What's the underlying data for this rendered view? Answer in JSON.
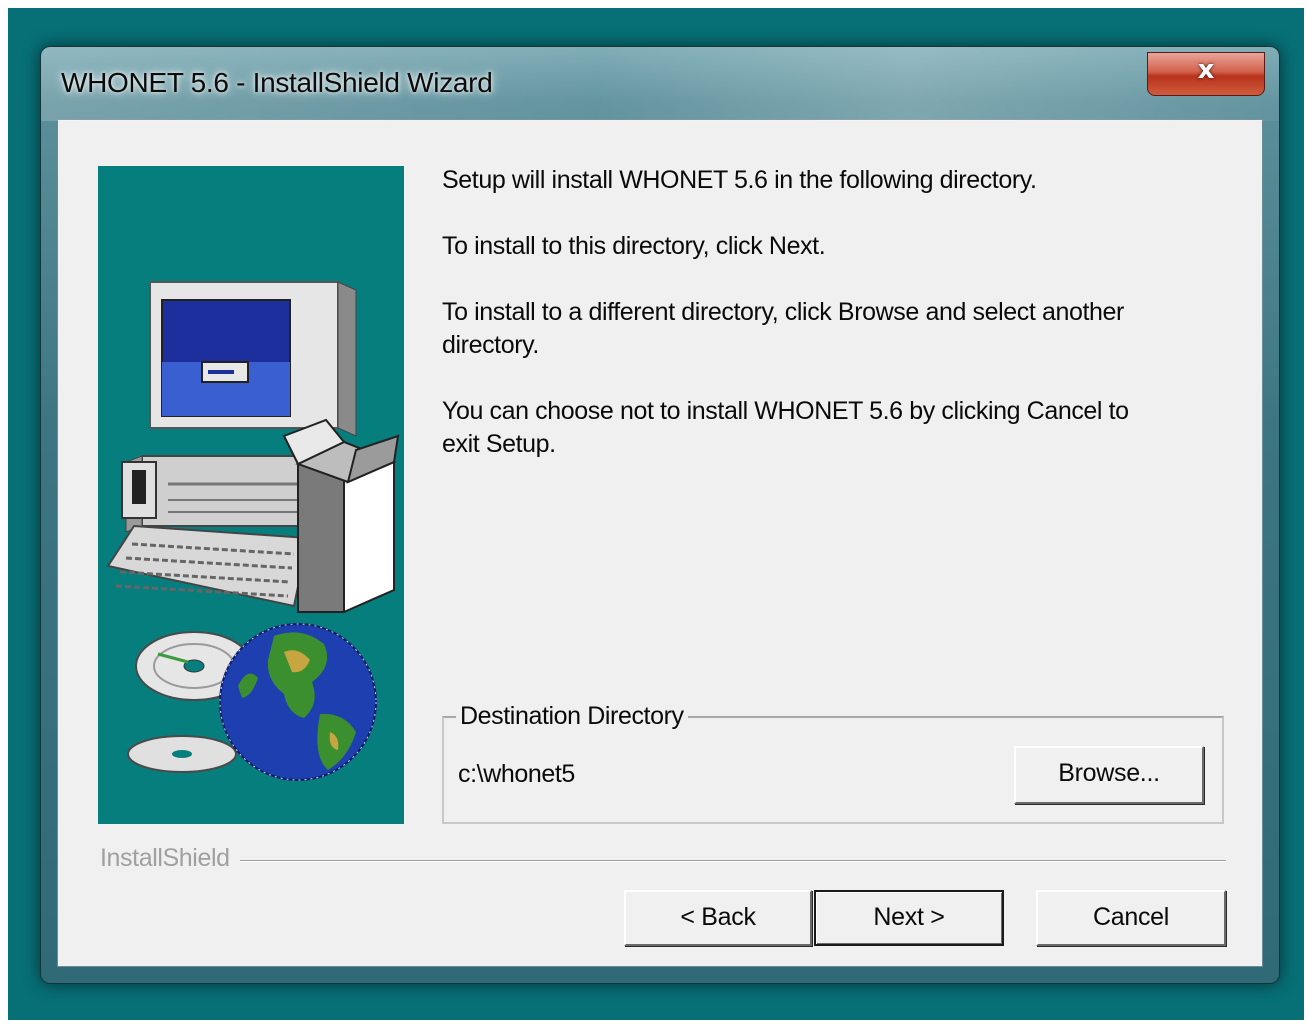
{
  "window": {
    "title": "WHONET 5.6 - InstallShield Wizard",
    "close_glyph": "x"
  },
  "content": {
    "line1": "Setup will install WHONET 5.6 in the following directory.",
    "line2": "To install to this directory, click Next.",
    "line3a": "To install to a different directory, click Browse and select another",
    "line3b": "directory.",
    "line4a": "You can choose not to install WHONET 5.6 by clicking Cancel to",
    "line4b": "exit Setup."
  },
  "destination": {
    "group_label": "Destination Directory",
    "path": "c:\\whonet5",
    "browse_label": "Browse..."
  },
  "footer": {
    "brand": "InstallShield",
    "back_label": "< Back",
    "next_label": "Next >",
    "cancel_label": "Cancel"
  },
  "colors": {
    "desktop": "#076f76",
    "banner": "#077e7e",
    "dialog_face": "#f0f0f0",
    "close_button": "#c7422a"
  },
  "icons": [
    "close-icon",
    "computer-illustration",
    "cd-disc-icon",
    "globe-icon"
  ]
}
